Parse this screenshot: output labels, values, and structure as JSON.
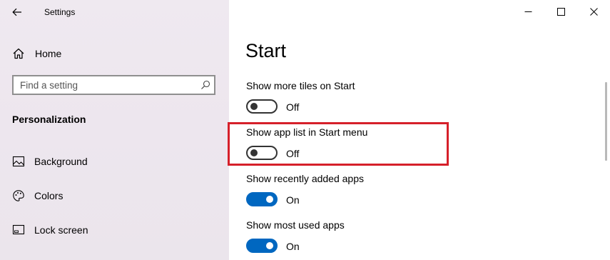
{
  "window": {
    "title": "Settings",
    "controls": {
      "minimize": "minimize",
      "maximize": "maximize",
      "close": "close"
    }
  },
  "sidebar": {
    "home_label": "Home",
    "search": {
      "placeholder": "Find a setting",
      "value": ""
    },
    "section_heading": "Personalization",
    "items": [
      {
        "label": "Background",
        "icon": "picture-icon"
      },
      {
        "label": "Colors",
        "icon": "palette-icon"
      },
      {
        "label": "Lock screen",
        "icon": "lock-screen-icon"
      }
    ]
  },
  "main": {
    "title": "Start",
    "settings": [
      {
        "label": "Show more tiles on Start",
        "state": "Off",
        "on": false
      },
      {
        "label": "Show app list in Start menu",
        "state": "Off",
        "on": false,
        "highlighted": true
      },
      {
        "label": "Show recently added apps",
        "state": "On",
        "on": true
      },
      {
        "label": "Show most used apps",
        "state": "On",
        "on": true
      }
    ]
  },
  "colors": {
    "accent": "#0067c0",
    "highlight": "#d6202a",
    "sidebar_bg": "#ede6ee"
  }
}
